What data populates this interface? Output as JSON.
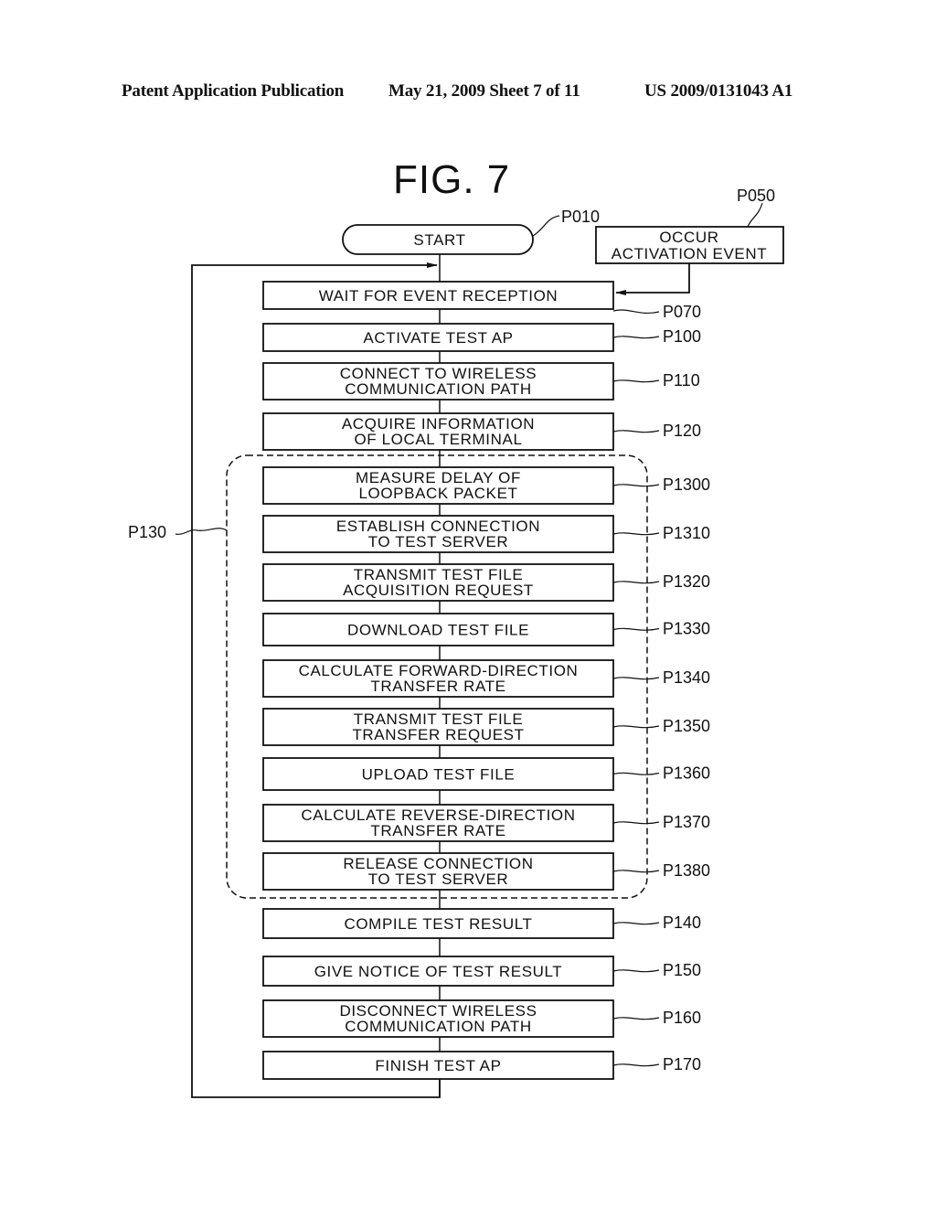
{
  "header": {
    "publication": "Patent Application Publication",
    "date_sheet": "May 21, 2009  Sheet 7 of 11",
    "patent_number": "US 2009/0131043 A1"
  },
  "figure": {
    "title": "FIG. 7",
    "start": {
      "label": "START",
      "ref": "P010"
    },
    "event": {
      "lines": [
        "OCCUR",
        "ACTIVATION EVENT"
      ],
      "ref": "P050"
    },
    "group": {
      "ref": "P130"
    },
    "steps": [
      {
        "lines": [
          "WAIT FOR EVENT RECEPTION"
        ],
        "ref": "P070",
        "in_group": false
      },
      {
        "lines": [
          "ACTIVATE TEST AP"
        ],
        "ref": "P100",
        "in_group": false
      },
      {
        "lines": [
          "CONNECT TO WIRELESS",
          "COMMUNICATION PATH"
        ],
        "ref": "P110",
        "in_group": false
      },
      {
        "lines": [
          "ACQUIRE INFORMATION",
          "OF LOCAL TERMINAL"
        ],
        "ref": "P120",
        "in_group": false
      },
      {
        "lines": [
          "MEASURE DELAY OF",
          "LOOPBACK PACKET"
        ],
        "ref": "P1300",
        "in_group": true
      },
      {
        "lines": [
          "ESTABLISH CONNECTION",
          "TO TEST SERVER"
        ],
        "ref": "P1310",
        "in_group": true
      },
      {
        "lines": [
          "TRANSMIT TEST FILE",
          "ACQUISITION REQUEST"
        ],
        "ref": "P1320",
        "in_group": true
      },
      {
        "lines": [
          "DOWNLOAD TEST FILE"
        ],
        "ref": "P1330",
        "in_group": true
      },
      {
        "lines": [
          "CALCULATE FORWARD-DIRECTION",
          "TRANSFER RATE"
        ],
        "ref": "P1340",
        "in_group": true
      },
      {
        "lines": [
          "TRANSMIT TEST FILE",
          "TRANSFER REQUEST"
        ],
        "ref": "P1350",
        "in_group": true
      },
      {
        "lines": [
          "UPLOAD TEST FILE"
        ],
        "ref": "P1360",
        "in_group": true
      },
      {
        "lines": [
          "CALCULATE REVERSE-DIRECTION",
          "TRANSFER RATE"
        ],
        "ref": "P1370",
        "in_group": true
      },
      {
        "lines": [
          "RELEASE CONNECTION",
          "TO TEST SERVER"
        ],
        "ref": "P1380",
        "in_group": true
      },
      {
        "lines": [
          "COMPILE TEST RESULT"
        ],
        "ref": "P140",
        "in_group": false
      },
      {
        "lines": [
          "GIVE NOTICE OF TEST RESULT"
        ],
        "ref": "P150",
        "in_group": false
      },
      {
        "lines": [
          "DISCONNECT WIRELESS",
          "COMMUNICATION PATH"
        ],
        "ref": "P160",
        "in_group": false
      },
      {
        "lines": [
          "FINISH TEST AP"
        ],
        "ref": "P170",
        "in_group": false
      }
    ]
  }
}
